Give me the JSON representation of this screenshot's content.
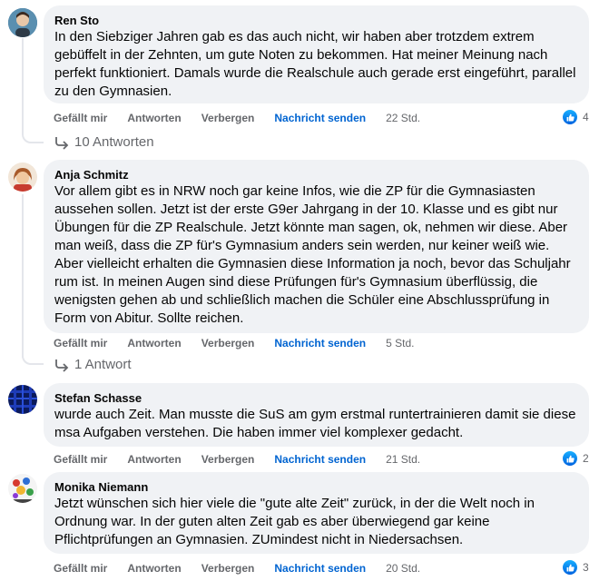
{
  "comments": [
    {
      "author": "Ren Sto",
      "text": "In den Siebziger Jahren gab es das auch nicht, wir haben aber trotzdem extrem gebüffelt in der Zehnten, um gute Noten zu bekommen. Hat meiner Meinung nach perfekt funktioniert. Damals wurde die Realschule auch gerade erst eingeführt, parallel zu den Gymnasien.",
      "like_label": "Gefällt mir",
      "reply_label": "Antworten",
      "hide_label": "Verbergen",
      "send_label": "Nachricht senden",
      "time": "22 Std.",
      "likes": "4",
      "replies_link": "10 Antworten"
    },
    {
      "author": "Anja Schmitz",
      "text": "Vor allem gibt es in NRW noch gar keine Infos, wie die ZP für die Gymnasiasten aussehen sollen. Jetzt ist der erste G9er Jahrgang in der 10. Klasse und es gibt nur Übungen für die ZP Realschule. Jetzt könnte man sagen, ok, nehmen wir diese. Aber man weiß, dass die ZP für's Gymnasium anders sein werden, nur keiner weiß wie. Aber vielleicht erhalten die Gymnasien diese Information ja noch, bevor das Schuljahr rum ist. In meinen Augen sind diese Prüfungen für's Gymnasium überflüssig, die wenigsten gehen ab und schließlich machen die Schüler eine Abschlussprüfung in Form von Abitur. Sollte reichen.",
      "like_label": "Gefällt mir",
      "reply_label": "Antworten",
      "hide_label": "Verbergen",
      "send_label": "Nachricht senden",
      "time": "5 Std.",
      "likes": "",
      "replies_link": "1 Antwort"
    },
    {
      "author": "Stefan Schasse",
      "text": "wurde auch Zeit. Man musste die SuS am gym erstmal runtertrainieren damit sie diese msa Aufgaben verstehen. Die haben immer viel komplexer gedacht.",
      "like_label": "Gefällt mir",
      "reply_label": "Antworten",
      "hide_label": "Verbergen",
      "send_label": "Nachricht senden",
      "time": "21 Std.",
      "likes": "2",
      "replies_link": ""
    },
    {
      "author": "Monika Niemann",
      "text": "Jetzt wünschen sich hier viele die \"gute alte Zeit\" zurück, in der die Welt noch in Ordnung war. In der guten alten Zeit gab es aber überwiegend gar keine Pflichtprüfungen an Gymnasien. ZUmindest nicht in Niedersachsen.",
      "like_label": "Gefällt mir",
      "reply_label": "Antworten",
      "hide_label": "Verbergen",
      "send_label": "Nachricht senden",
      "time": "20 Std.",
      "likes": "3",
      "replies_link": ""
    }
  ],
  "icons": {
    "like_reaction": "thumbs-up-icon",
    "reply_arrow": "reply-arrow-icon"
  },
  "colors": {
    "bubble": "#f0f2f5",
    "link_blue": "#0064d1",
    "secondary_text": "#65676b",
    "reaction_blue": "#0866ff"
  }
}
